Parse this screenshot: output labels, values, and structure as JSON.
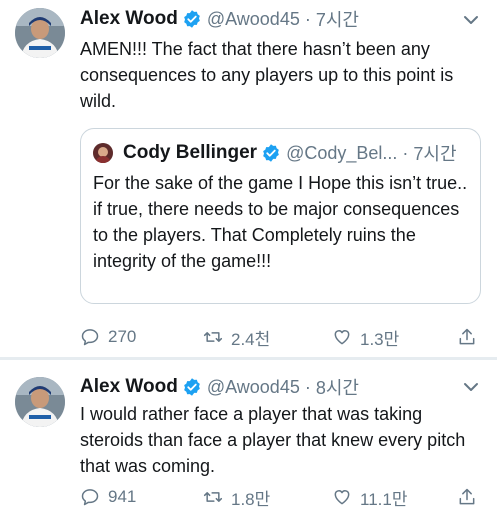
{
  "tweets": [
    {
      "author": {
        "name": "Alex Wood",
        "handle": "@Awood45",
        "verified": true,
        "avatar": "avatar-dodgers-player"
      },
      "time": "7시간",
      "text": "AMEN!!! The fact that there hasn’t been any consequences to any players up to this point is wild.",
      "quote": {
        "author": {
          "name": "Cody Bellinger",
          "handle": "@Cody_Bel...",
          "verified": true,
          "avatar": "avatar-bellinger"
        },
        "time": "7시간",
        "text": "For the sake of the game I Hope this isn’t true.. if true, there needs to be major consequences to the players. That Completely ruins the integrity of the game!!!"
      },
      "actions": {
        "replies": "270",
        "retweets": "2.4천",
        "likes": "1.3만"
      }
    },
    {
      "author": {
        "name": "Alex Wood",
        "handle": "@Awood45",
        "verified": true,
        "avatar": "avatar-dodgers-player"
      },
      "time": "8시간",
      "text": "I would rather face a player that was taking steroids than face a player that knew every pitch that was coming.",
      "actions": {
        "replies": "941",
        "retweets": "1.8만",
        "likes": "11.1만"
      }
    }
  ],
  "separator": "·",
  "icons": [
    "verified-badge-icon",
    "chevron-down-icon",
    "reply-icon",
    "retweet-icon",
    "like-icon",
    "share-icon"
  ],
  "colors": {
    "accent": "#1da1f2",
    "text": "#14171a",
    "secondary": "#657786",
    "border": "#ccd6dd",
    "divider": "#e6ecf0"
  }
}
